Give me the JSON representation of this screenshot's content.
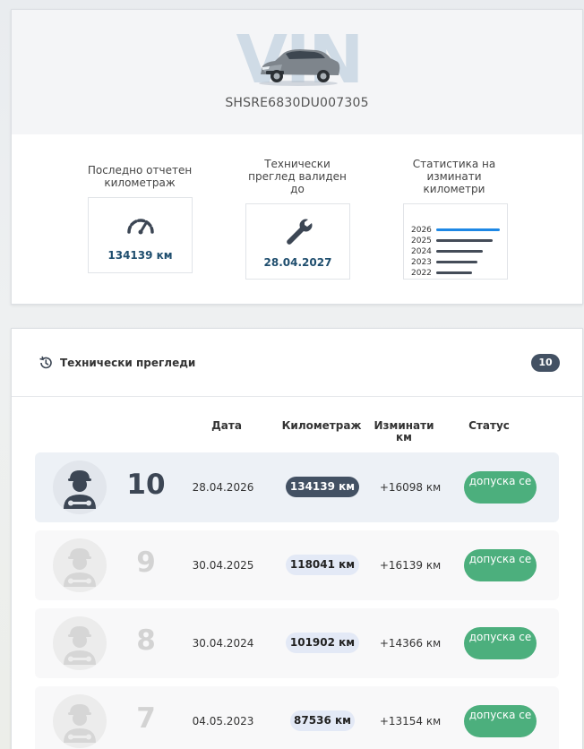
{
  "vehicle": {
    "vin_logo_text": "VIN",
    "vin_number": "SHSRE6830DU007305"
  },
  "stats": {
    "mileage": {
      "title": "Последно отчетен километраж",
      "value": "134139 км",
      "icon": "speedometer-icon"
    },
    "inspection": {
      "title": "Технически преглед валиден до",
      "value": "28.04.2027",
      "icon": "wrench-icon"
    },
    "km_stats": {
      "title": "Статистика на изминати километри",
      "rows": [
        {
          "year": "2026",
          "level": 0.62,
          "color": "#1e88e5"
        },
        {
          "year": "2025",
          "level": 0.55,
          "color": "#444c58"
        },
        {
          "year": "2024",
          "level": 0.45,
          "color": "#444c58"
        },
        {
          "year": "2023",
          "level": 0.4,
          "color": "#444c58"
        },
        {
          "year": "2022",
          "level": 0.35,
          "color": "#444c58"
        }
      ]
    }
  },
  "inspections": {
    "title": "Технически прегледи",
    "count": "10",
    "icon": "history-icon",
    "columns": {
      "date": "Дата",
      "mileage": "Километраж",
      "driven": "Изминати км",
      "status": "Статус"
    },
    "rows": [
      {
        "number": "10",
        "date": "28.04.2026",
        "mileage": "134139 км",
        "driven": "+16098 км",
        "status": "допуска се",
        "active": true
      },
      {
        "number": "9",
        "date": "30.04.2025",
        "mileage": "118041 км",
        "driven": "+16139 км",
        "status": "допуска се",
        "active": false
      },
      {
        "number": "8",
        "date": "30.04.2024",
        "mileage": "101902 км",
        "driven": "+14366 км",
        "status": "допуска се",
        "active": false
      },
      {
        "number": "7",
        "date": "04.05.2023",
        "mileage": "87536 км",
        "driven": "+13154 км",
        "status": "допуска се",
        "active": false
      }
    ]
  },
  "colors": {
    "accent_dark": "#435163",
    "status_green": "#4caf7d",
    "value_blue": "#1f4e6e",
    "chart_highlight": "#1e88e5"
  }
}
